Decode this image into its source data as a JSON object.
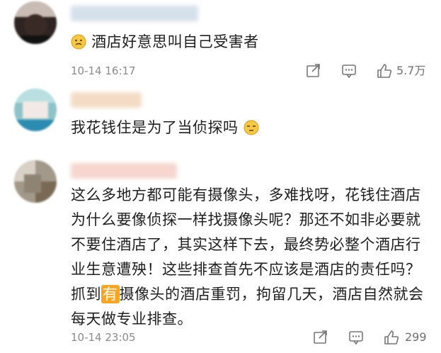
{
  "comments": [
    {
      "text": "酒店好意思叫自己受害者",
      "time": "10-14 16:17",
      "likes": "5.7万",
      "avatar_colors": [
        "#3a2a26",
        "#c9b9b2",
        "#111111"
      ],
      "name_color": "#d6e0ea"
    },
    {
      "text": "我花钱住是为了当侦探吗",
      "likes": "",
      "avatar_colors": [
        "#8ec4c9",
        "#2c8bb0",
        "#f1e9e5"
      ],
      "name_color": "#f3dcc6"
    },
    {
      "text_before": "这么多地方都可能有摄像头，多难找呀，花钱住酒店为什么要像侦探一样找摄像头呢？那还不如非必要就不要住酒店了，其实这样下去，最终势必整个酒店行业生意遭殃！这些排查首先不应该是酒店的责任吗？抓到",
      "tag_text": "有",
      "text_after": "摄像头的酒店重罚，拘留几天，酒店自然就会每天做专业排查。",
      "time": "10-14 23:05",
      "likes": "299",
      "avatar_colors": [
        "#a3998a",
        "#7a6a55",
        "#d8d2c6"
      ],
      "name_color": "#f6d6cf"
    }
  ],
  "icons": [
    "forward-icon",
    "comment-icon",
    "like-icon"
  ],
  "colors": {
    "meta_text": "#8a8a8a",
    "body_text": "#1f1f1f",
    "tag_bg": "#f6a623"
  }
}
